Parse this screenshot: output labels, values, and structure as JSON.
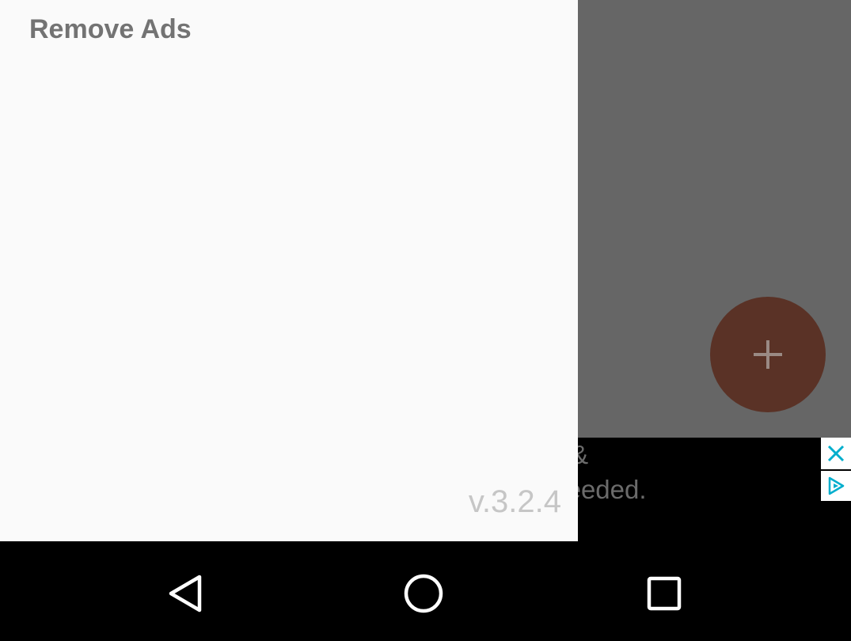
{
  "drawer": {
    "menu_item": "Remove Ads",
    "version": "v.3.2.4"
  },
  "fab": {
    "icon": "plus-icon",
    "color": "#5a3226"
  },
  "ad": {
    "line1": "sed clothes &",
    "line2": "pintments needed.",
    "close_icon": "close-icon",
    "adchoices_icon": "adchoices-icon",
    "accent": "#00aecd"
  },
  "nav": {
    "back_icon": "back-icon",
    "home_icon": "home-icon",
    "recents_icon": "recents-icon"
  }
}
